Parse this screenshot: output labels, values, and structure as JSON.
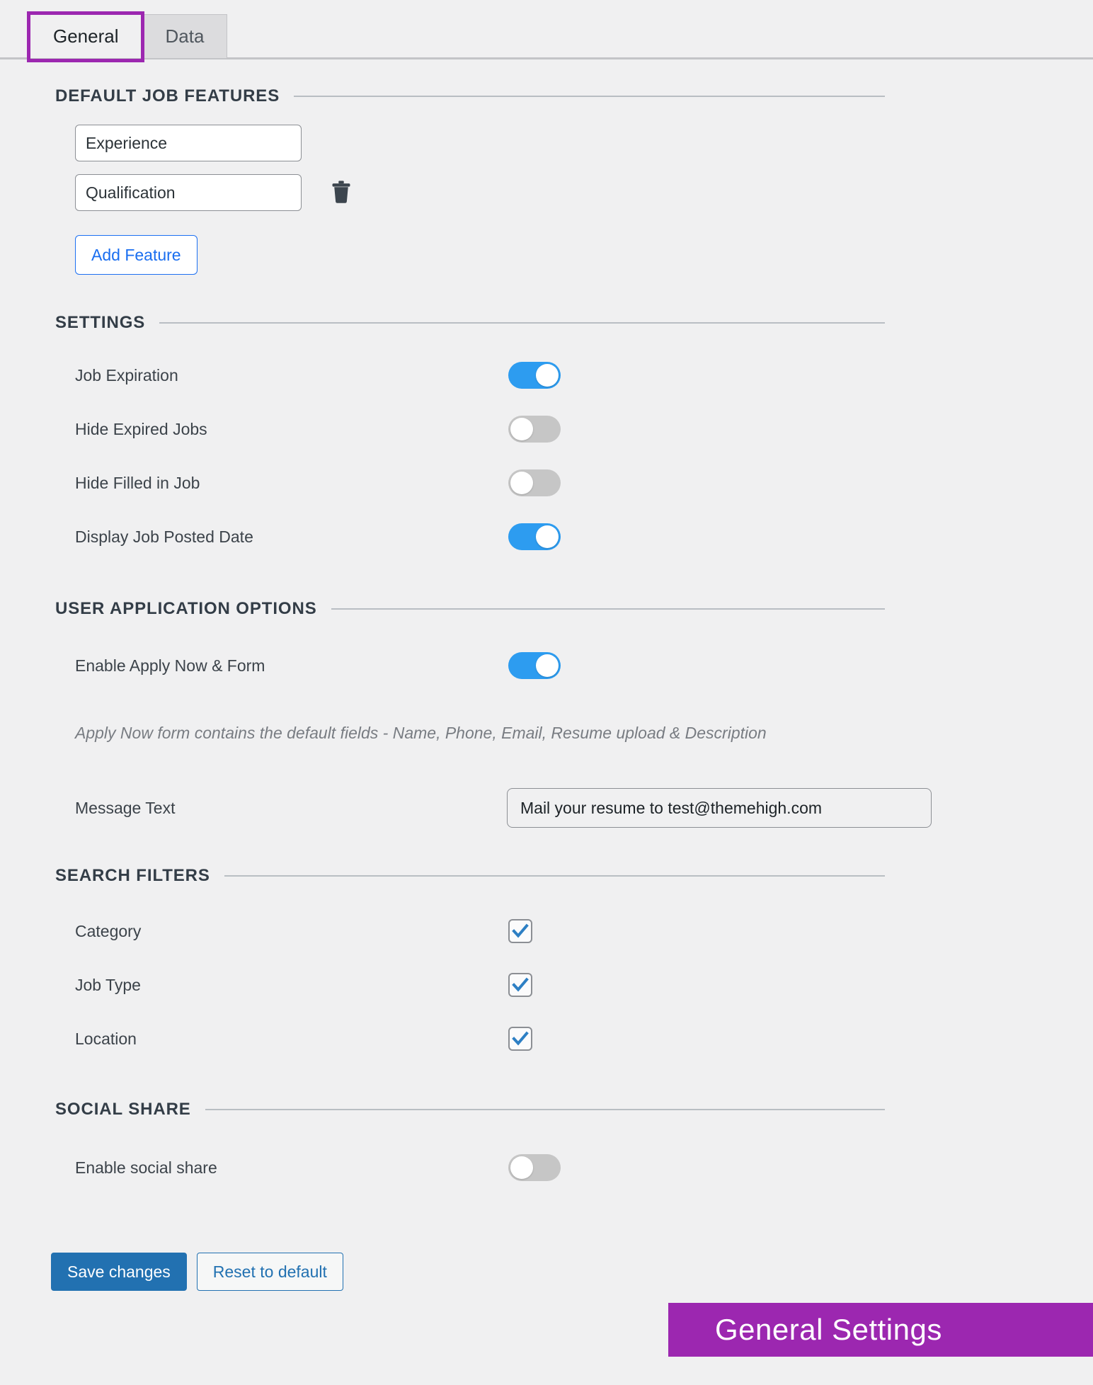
{
  "tabs": [
    {
      "label": "General",
      "active": true
    },
    {
      "label": "Data",
      "active": false
    }
  ],
  "sections": {
    "default_job_features": {
      "title": "DEFAULT JOB FEATURES",
      "features": [
        {
          "value": "Experience",
          "placeholder": "Feature name",
          "deletable": false
        },
        {
          "value": "Qualification",
          "placeholder": "Feature name",
          "deletable": true
        }
      ],
      "add_button": "Add Feature"
    },
    "settings": {
      "title": "SETTINGS",
      "options": [
        {
          "label": "Job Expiration",
          "state": "on"
        },
        {
          "label": "Hide Expired Jobs",
          "state": "off"
        },
        {
          "label": "Hide Filled in Job",
          "state": "off"
        },
        {
          "label": "Display Job Posted Date",
          "state": "on"
        }
      ]
    },
    "user_application_options": {
      "title": "USER APPLICATION OPTIONS",
      "options": [
        {
          "label": "Enable Apply Now & Form",
          "state": "on"
        }
      ],
      "help_text": "Apply Now form contains the default fields - Name, Phone, Email, Resume upload & Description",
      "message_text_label": "Message Text",
      "message_text_value": "Mail your resume to test@themehigh.com",
      "message_text_placeholder": "Message Text"
    },
    "search_filters": {
      "title": "SEARCH FILTERS",
      "options": [
        {
          "label": "Category",
          "checked": true
        },
        {
          "label": "Job Type",
          "checked": true
        },
        {
          "label": "Location",
          "checked": true
        }
      ]
    },
    "social_share": {
      "title": "SOCIAL SHARE",
      "options": [
        {
          "label": "Enable social share",
          "state": "off"
        }
      ]
    }
  },
  "footer": {
    "save_label": "Save changes",
    "reset_label": "Reset to default"
  },
  "annotation": {
    "label": "General Settings"
  },
  "colors": {
    "page_background": "#f0f0f1",
    "toggle_on": "#2d9cf0",
    "toggle_off": "#c6c6c6",
    "accent_blue": "#2271b1",
    "link_blue": "#1a6ef0",
    "annotation_purple": "#9c27b0",
    "section_title": "#333d47",
    "body_text": "#3c434a",
    "help_text": "#787c82"
  },
  "icons": {
    "trash": "trash-icon",
    "check": "check-icon"
  }
}
